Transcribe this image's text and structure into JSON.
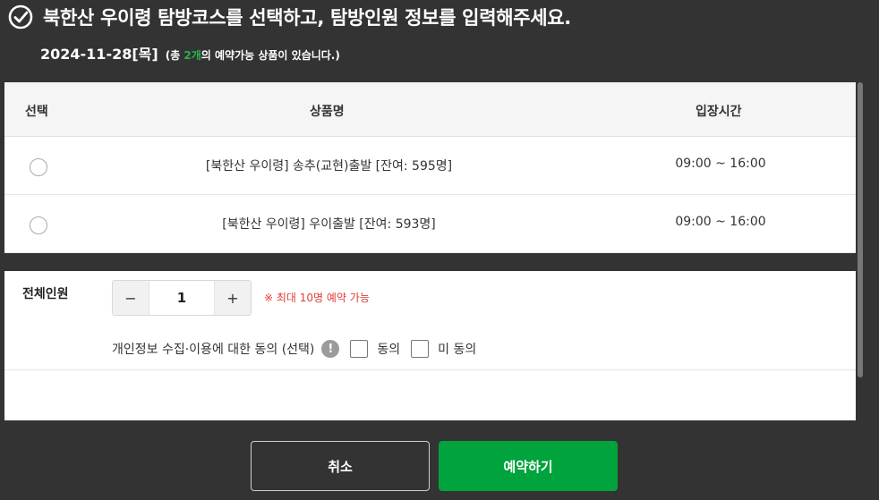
{
  "header": {
    "title": "북한산 우이령 탐방코스를 선택하고, 탐방인원 정보를 입력해주세요.",
    "date": "2024-11-28[목]",
    "summary_prefix": "(총 ",
    "summary_count": "2개",
    "summary_suffix": "의 예약가능 상품이 있습니다.)",
    "check_icon": "check-circle-icon"
  },
  "table": {
    "columns": [
      "선택",
      "상품명",
      "입장시간"
    ],
    "rows": [
      {
        "name": "[북한산 우이령] 송추(교현)출발 [잔여: 595명]",
        "time": "09:00 ~ 16:00"
      },
      {
        "name": "[북한산 우이령] 우이출발 [잔여: 593명]",
        "time": "09:00 ~ 16:00"
      }
    ]
  },
  "people": {
    "label": "전체인원",
    "minus": "−",
    "plus": "+",
    "value": "1",
    "limit_note": "※ 최대 10명 예약 가능"
  },
  "consent": {
    "label": "개인정보 수집·이용에 대한 동의 (선택)",
    "info_icon": "!",
    "agree": "동의",
    "disagree": "미 동의"
  },
  "actions": {
    "cancel": "취소",
    "reserve": "예약하기"
  },
  "colors": {
    "background": "#333333",
    "accent_green": "#00a33c",
    "count_green": "#27b14a",
    "warning_red": "#e33b3b"
  }
}
